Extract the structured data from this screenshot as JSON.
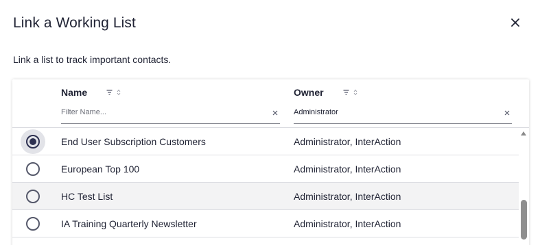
{
  "dialog": {
    "title": "Link a Working List",
    "subtitle": "Link a list to track important contacts.",
    "close_glyph": "×"
  },
  "columns": {
    "name": {
      "label": "Name",
      "filter_placeholder": "Filter Name...",
      "filter_value": ""
    },
    "owner": {
      "label": "Owner",
      "filter_placeholder": "",
      "filter_value": "Administrator"
    }
  },
  "rows": [
    {
      "name": "End User Subscription Customers",
      "owner": "Administrator, InterAction",
      "selected": true
    },
    {
      "name": "European Top 100",
      "owner": "Administrator, InterAction",
      "selected": false
    },
    {
      "name": "HC Test List",
      "owner": "Administrator, InterAction",
      "selected": false
    },
    {
      "name": "IA Training Quarterly Newsletter",
      "owner": "Administrator, InterAction",
      "selected": false
    }
  ],
  "colors": {
    "text": "#1f2233",
    "radio_selected": "#2d3050",
    "row_alt_bg": "#f3f3f4",
    "selected_halo": "#e2e3e8",
    "scroll_thumb": "#8e8e8e"
  }
}
